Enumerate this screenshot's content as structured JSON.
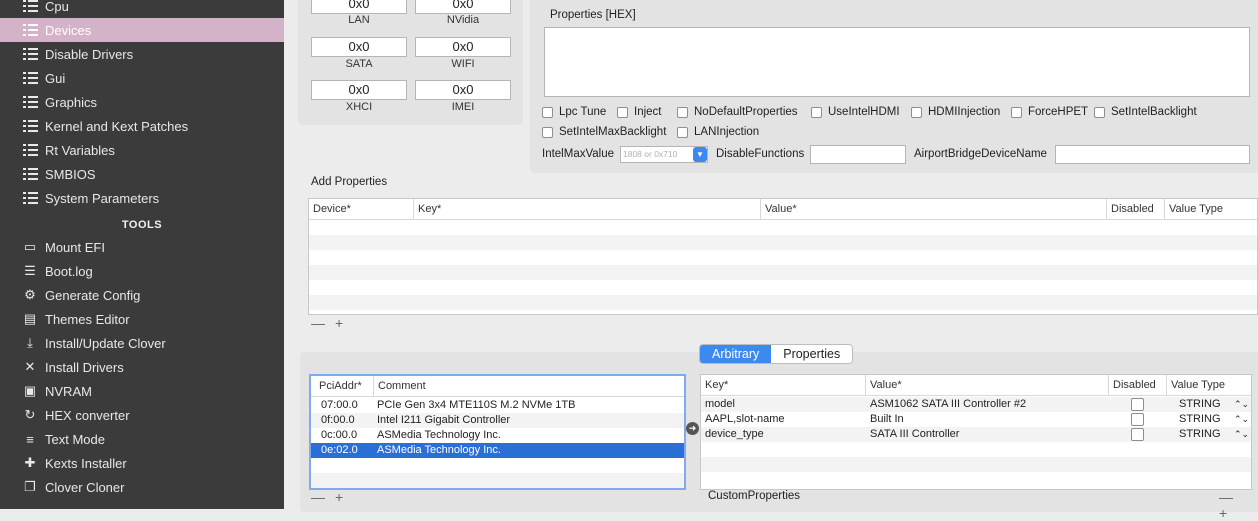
{
  "sidebar": {
    "items": [
      {
        "label": "Cpu",
        "icon": "list-icon"
      },
      {
        "label": "Devices",
        "icon": "list-icon",
        "selected": true
      },
      {
        "label": "Disable Drivers",
        "icon": "list-icon"
      },
      {
        "label": "Gui",
        "icon": "list-icon"
      },
      {
        "label": "Graphics",
        "icon": "list-icon"
      },
      {
        "label": "Kernel and Kext Patches",
        "icon": "list-icon"
      },
      {
        "label": "Rt Variables",
        "icon": "list-icon"
      },
      {
        "label": "SMBIOS",
        "icon": "list-icon"
      },
      {
        "label": "System Parameters",
        "icon": "list-icon"
      }
    ],
    "tools_heading": "TOOLS",
    "tools": [
      {
        "label": "Mount EFI",
        "icon": "drive-icon"
      },
      {
        "label": "Boot.log",
        "icon": "log-icon"
      },
      {
        "label": "Generate Config",
        "icon": "gears-icon"
      },
      {
        "label": "Themes Editor",
        "icon": "themes-icon"
      },
      {
        "label": "Install/Update Clover",
        "icon": "download-icon"
      },
      {
        "label": "Install Drivers",
        "icon": "wrench-icon"
      },
      {
        "label": "NVRAM",
        "icon": "chip-icon"
      },
      {
        "label": "HEX converter",
        "icon": "refresh-icon"
      },
      {
        "label": "Text Mode",
        "icon": "text-icon"
      },
      {
        "label": "Kexts Installer",
        "icon": "puzzle-icon"
      },
      {
        "label": "Clover Cloner",
        "icon": "clone-icon"
      }
    ]
  },
  "fake_ids": [
    {
      "value": "0x0",
      "label": "LAN"
    },
    {
      "value": "0x0",
      "label": "NVidia"
    },
    {
      "value": "0x0",
      "label": "SATA"
    },
    {
      "value": "0x0",
      "label": "WIFI"
    },
    {
      "value": "0x0",
      "label": "XHCI"
    },
    {
      "value": "0x0",
      "label": "IMEI"
    }
  ],
  "properties": {
    "hex_label": "Properties [HEX]",
    "checkboxes": [
      {
        "label": "Lpc Tune",
        "checked": false
      },
      {
        "label": "Inject",
        "checked": false
      },
      {
        "label": "NoDefaultProperties",
        "checked": false
      },
      {
        "label": "UseIntelHDMI",
        "checked": false
      },
      {
        "label": "HDMIInjection",
        "checked": false
      },
      {
        "label": "ForceHPET",
        "checked": false
      },
      {
        "label": "SetIntelBacklight",
        "checked": false
      },
      {
        "label": "SetIntelMaxBacklight",
        "checked": false
      },
      {
        "label": "LANInjection",
        "checked": false
      }
    ],
    "intel_max_value_label": "IntelMaxValue",
    "intel_max_value_placeholder": "1808 or 0x710",
    "disable_functions_label": "DisableFunctions",
    "airport_label": "AirportBridgeDeviceName"
  },
  "add_properties": {
    "title": "Add Properties",
    "columns": [
      "Device*",
      "Key*",
      "Value*",
      "Disabled",
      "Value Type"
    ]
  },
  "segments": {
    "arbitrary": "Arbitrary",
    "properties": "Properties",
    "active": "Arbitrary"
  },
  "pci_table": {
    "columns": [
      "PciAddr*",
      "Comment"
    ],
    "rows": [
      {
        "addr": "07:00.0",
        "comment": "PCIe Gen 3x4 MTE110S M.2 NVMe 1TB"
      },
      {
        "addr": "0f:00.0",
        "comment": "Intel I211 Gigabit Controller"
      },
      {
        "addr": "0c:00.0",
        "comment": "ASMedia Technology Inc."
      },
      {
        "addr": "0e:02.0",
        "comment": "ASMedia Technology Inc.",
        "selected": true
      }
    ]
  },
  "custom_table": {
    "columns": [
      "Key*",
      "Value*",
      "Disabled",
      "Value Type"
    ],
    "rows": [
      {
        "key": "model",
        "value": "ASM1062 SATA III Controller #2",
        "type": "STRING",
        "disabled": false
      },
      {
        "key": "AAPL,slot-name",
        "value": "Built In",
        "type": "STRING",
        "disabled": false
      },
      {
        "key": "device_type",
        "value": "SATA III Controller",
        "type": "STRING",
        "disabled": false
      }
    ],
    "footer_label": "CustomProperties"
  },
  "controls": {
    "minus": "—",
    "plus": "+",
    "stepper": "⌃⌄"
  },
  "colors": {
    "sidebar_bg": "#3b3b3b",
    "sidebar_selected": "#d4b3c8",
    "accent": "#3a8af0",
    "row_selected": "#2a6fd6"
  }
}
